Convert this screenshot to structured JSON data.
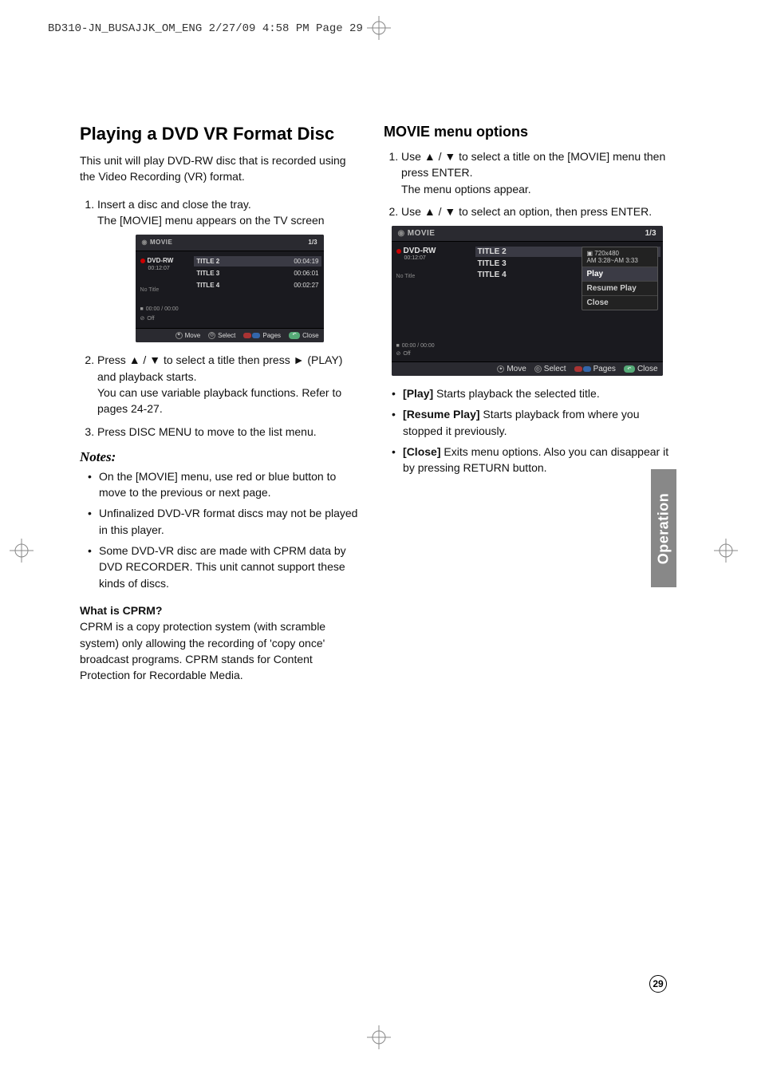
{
  "printHeader": "BD310-JN_BUSAJJK_OM_ENG  2/27/09  4:58 PM  Page 29",
  "sideLabel": "Operation",
  "pageNumber": "29",
  "left": {
    "heading": "Playing a DVD VR Format Disc",
    "intro": "This unit will play DVD-RW disc that is recorded using the Video Recording (VR) format.",
    "step1": "Insert a disc and close the tray.",
    "step1b": "The [MOVIE] menu appears on the TV screen",
    "step2a": "Press ",
    "step2b": " to select a title then press ",
    "step2c": " (PLAY) and playback starts.",
    "step2d": "You can use variable playback functions. Refer to pages 24-27.",
    "step3": "Press DISC MENU to move to the list menu.",
    "notesHeading": "Notes:",
    "note1": "On the [MOVIE] menu, use red or blue button to move to the previous or next page.",
    "note2": "Unfinalized DVD-VR format discs may not be played in this player.",
    "note3": "Some DVD-VR disc are made with CPRM data by DVD RECORDER. This unit cannot support these kinds of discs.",
    "cprmHeading": "What is CPRM?",
    "cprmBody": "CPRM is a copy protection system (with scramble system) only allowing the recording of 'copy once' broadcast programs. CPRM stands for Content Protection for Recordable Media."
  },
  "right": {
    "heading": "MOVIE menu options",
    "step1a": "Use ",
    "step1b": " to select a title on the [MOVIE] menu then press ENTER.",
    "step1c": "The menu options appear.",
    "step2a": "Use ",
    "step2b": " to select an option, then press ENTER.",
    "opt1Label": "[Play]",
    "opt1Text": " Starts playback the selected title.",
    "opt2Label": "[Resume Play]",
    "opt2Text": " Starts playback from where you stopped it previously.",
    "opt3Label": "[Close]",
    "opt3Text": " Exits menu options. Also you can disappear it by pressing RETURN button."
  },
  "symbols": {
    "updown": "▲ / ▼",
    "play": "►"
  },
  "ssSmall": {
    "title": "MOVIE",
    "page": "1/3",
    "disc": "DVD-RW",
    "discTime": "00:12:07",
    "noTitle": "No Title",
    "sideTime": "00:00 / 00:00",
    "sideOff": "Off",
    "row1t": "TITLE 2",
    "row1d": "00:04:19",
    "row2t": "TITLE 3",
    "row2d": "00:06:01",
    "row3t": "TITLE 4",
    "row3d": "00:02:27",
    "footMove": "Move",
    "footSelect": "Select",
    "footPages": "Pages",
    "footClose": "Close"
  },
  "ssLarge": {
    "title": "MOVIE",
    "page": "1/3",
    "disc": "DVD-RW",
    "discTime": "00:12:07",
    "noTitle": "No Title",
    "sideTime": "00:00 / 00:00",
    "sideOff": "Off",
    "row1t": "TITLE 2",
    "row2t": "TITLE 3",
    "row3t": "TITLE 4",
    "popRes": "720x480",
    "popTime": "AM 3:28~AM 3:33",
    "popPlay": "Play",
    "popResume": "Resume Play",
    "popClose": "Close",
    "footMove": "Move",
    "footSelect": "Select",
    "footPages": "Pages",
    "footClose": "Close"
  }
}
